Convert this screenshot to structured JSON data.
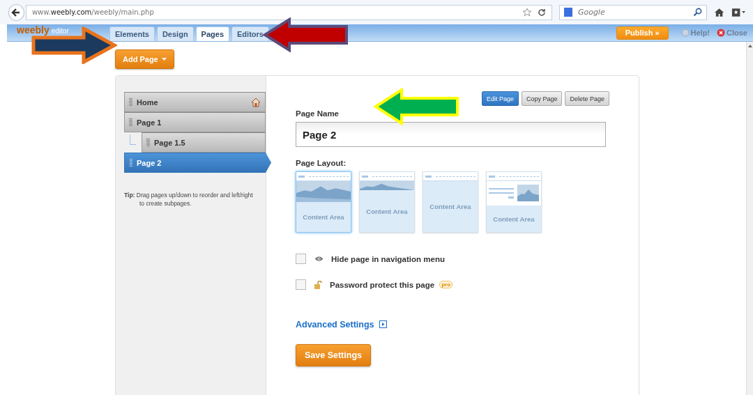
{
  "browser": {
    "url": "www.**weebly.com**/weebly/main.php",
    "search_placeholder": "Google"
  },
  "editor_bar": {
    "logo": "weebly",
    "logo_suffix": "editor",
    "tabs": [
      {
        "label": "Elements",
        "selected": false
      },
      {
        "label": "Design",
        "selected": false
      },
      {
        "label": "Pages",
        "selected": true
      },
      {
        "label": "Editors",
        "selected": false
      }
    ],
    "publish": "Publish »",
    "help": "Help!",
    "close": "Close"
  },
  "add_page": "Add Page",
  "pages": [
    {
      "label": "Home",
      "selected": false,
      "home": true
    },
    {
      "label": "Page 1",
      "selected": false,
      "home": false,
      "children": [
        {
          "label": "Page 1.5",
          "selected": false,
          "home": false
        }
      ]
    },
    {
      "label": "Page 2",
      "selected": true,
      "home": false
    }
  ],
  "tip": "**Tip:** Drag pages up/down to reorder and left/right to create subpages.",
  "actions": [
    {
      "label": "Edit Page",
      "selected": true
    },
    {
      "label": "Copy Page",
      "selected": false
    },
    {
      "label": "Delete Page",
      "selected": false
    }
  ],
  "page_name": {
    "label": "Page Name",
    "value": "Page 2"
  },
  "layout": {
    "label": "Page Layout:",
    "options": [
      {
        "kind": "banner",
        "label": "Content Area",
        "selected": true
      },
      {
        "kind": "short-banner",
        "label": "Content Area",
        "selected": false
      },
      {
        "kind": "plain",
        "label": "Content Area",
        "selected": false
      },
      {
        "kind": "text-image",
        "label": "Content Area",
        "selected": false
      }
    ]
  },
  "options": [
    {
      "kind": "eye",
      "label": "Hide page in navigation menu",
      "checked": false
    },
    {
      "kind": "lock",
      "label": "Password protect this page",
      "checked": false,
      "badge": "pro"
    }
  ],
  "advanced": "Advanced Settings",
  "save": "Save Settings"
}
